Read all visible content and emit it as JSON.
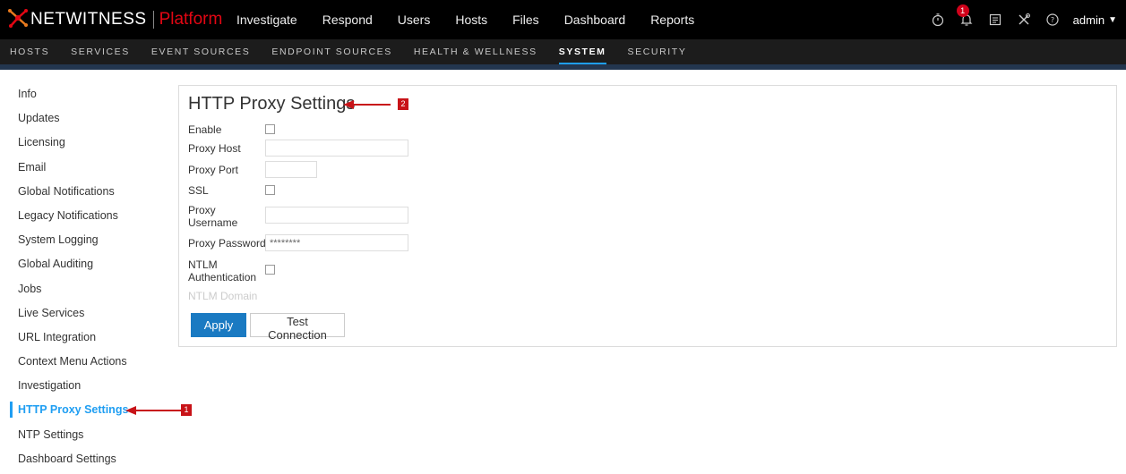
{
  "header": {
    "brand": "NETWITNESS",
    "product": "Platform",
    "nav": [
      "Investigate",
      "Respond",
      "Users",
      "Hosts",
      "Files",
      "Dashboard",
      "Reports"
    ],
    "notification_count": "1",
    "user": "admin",
    "icons": [
      "stopwatch-icon",
      "bell-icon",
      "notes-icon",
      "tools-icon",
      "help-icon"
    ]
  },
  "admin_tabs": {
    "items": [
      "HOSTS",
      "SERVICES",
      "EVENT SOURCES",
      "ENDPOINT SOURCES",
      "HEALTH & WELLNESS",
      "SYSTEM",
      "SECURITY"
    ],
    "active": "SYSTEM"
  },
  "sidebar": {
    "items": [
      "Info",
      "Updates",
      "Licensing",
      "Email",
      "Global Notifications",
      "Legacy Notifications",
      "System Logging",
      "Global Auditing",
      "Jobs",
      "Live Services",
      "URL Integration",
      "Context Menu Actions",
      "Investigation",
      "HTTP Proxy Settings",
      "NTP Settings",
      "Dashboard Settings"
    ],
    "active": "HTTP Proxy Settings"
  },
  "form": {
    "title": "HTTP Proxy Settings",
    "enable_label": "Enable",
    "enable_checked": false,
    "host_label": "Proxy Host",
    "host_value": "",
    "port_label": "Proxy Port",
    "port_value": "",
    "ssl_label": "SSL",
    "ssl_checked": false,
    "username_label_line1": "Proxy",
    "username_label_line2": "Username",
    "username_value": "",
    "password_label": "Proxy Password",
    "password_value": "********",
    "ntlm_label_line1": "NTLM",
    "ntlm_label_line2": "Authentication",
    "ntlm_checked": false,
    "ntlm_domain_label": "NTLM Domain",
    "apply_label": "Apply",
    "test_label": "Test Connection"
  },
  "callouts": {
    "sidebar_marker": "1",
    "title_marker": "2",
    "color": "#c81318"
  },
  "colors": {
    "accent": "#1f9ef2",
    "primary_button": "#1a7ac2",
    "brand_red": "#e30613"
  }
}
